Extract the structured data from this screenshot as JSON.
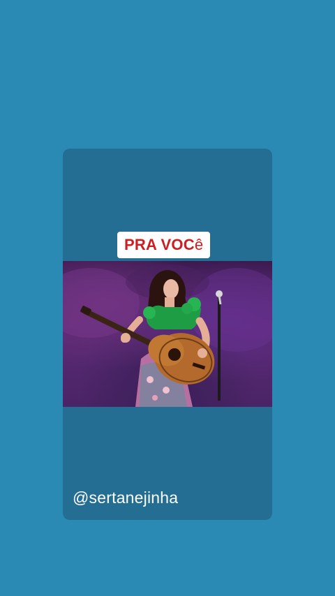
{
  "story": {
    "caption_bold": "PRA VOC",
    "caption_light": "ê",
    "username": "@sertanejinha",
    "video": {
      "scene": "woman-playing-acoustic-guitar-on-stage-icon"
    }
  },
  "colors": {
    "background": "#2a8ab4",
    "card": "#246d93",
    "caption_text": "#cc1f24",
    "caption_bg": "#ffffff",
    "username_text": "#ffffff"
  }
}
